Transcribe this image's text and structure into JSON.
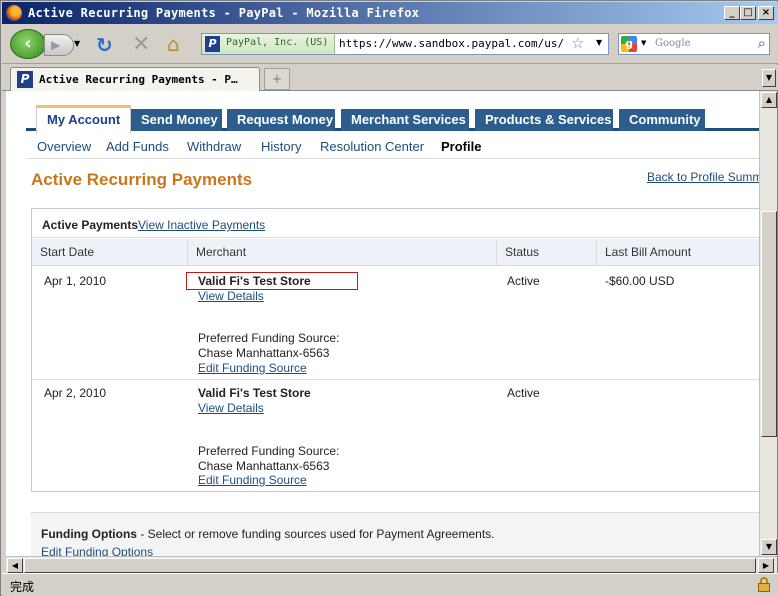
{
  "window": {
    "title": "Active Recurring Payments - PayPal - Mozilla Firefox",
    "min_glyph": "_",
    "max_glyph": "□",
    "close_glyph": "×"
  },
  "toolbar": {
    "site_identity": "PayPal, Inc. (US)",
    "url": "https://www.sandbox.paypal.com/us/cgi-",
    "search_placeholder": "Google"
  },
  "tab": {
    "title": "Active Recurring Payments - P…",
    "new_tab_glyph": "+"
  },
  "paypal_nav": {
    "tabs": [
      {
        "label": "My Account"
      },
      {
        "label": "Send Money"
      },
      {
        "label": "Request Money"
      },
      {
        "label": "Merchant Services"
      },
      {
        "label": "Products & Services"
      },
      {
        "label": "Community"
      }
    ],
    "subnav": [
      {
        "label": "Overview"
      },
      {
        "label": "Add Funds"
      },
      {
        "label": "Withdraw"
      },
      {
        "label": "History"
      },
      {
        "label": "Resolution Center"
      },
      {
        "label": "Profile"
      }
    ]
  },
  "page": {
    "title": "Active Recurring Payments",
    "back_link": "Back to Profile Summ"
  },
  "payments": {
    "heading": "Active Payments",
    "view_inactive": "View Inactive Payments",
    "columns": [
      "Start Date",
      "Merchant",
      "Status",
      "Last Bill Amount"
    ],
    "rows": [
      {
        "start_date": "Apr 1, 2010",
        "merchant": "Valid Fi's Test Store",
        "view_details": "View Details",
        "funding_label": "Preferred Funding Source:",
        "funding_source": "Chase Manhattanx-6563",
        "edit_funding": "Edit Funding Source",
        "status": "Active",
        "last_bill": "-$60.00 USD"
      },
      {
        "start_date": "Apr 2, 2010",
        "merchant": "Valid Fi's Test Store",
        "view_details": "View Details",
        "funding_label": "Preferred Funding Source:",
        "funding_source": "Chase Manhattanx-6563",
        "edit_funding": "Edit Funding Source",
        "status": "Active",
        "last_bill": ""
      }
    ]
  },
  "funding_options": {
    "title": "Funding Options",
    "description": " - Select or remove funding sources used for Payment Agreements.",
    "link": "Edit Funding Options"
  },
  "status_bar": {
    "text": "完成"
  }
}
